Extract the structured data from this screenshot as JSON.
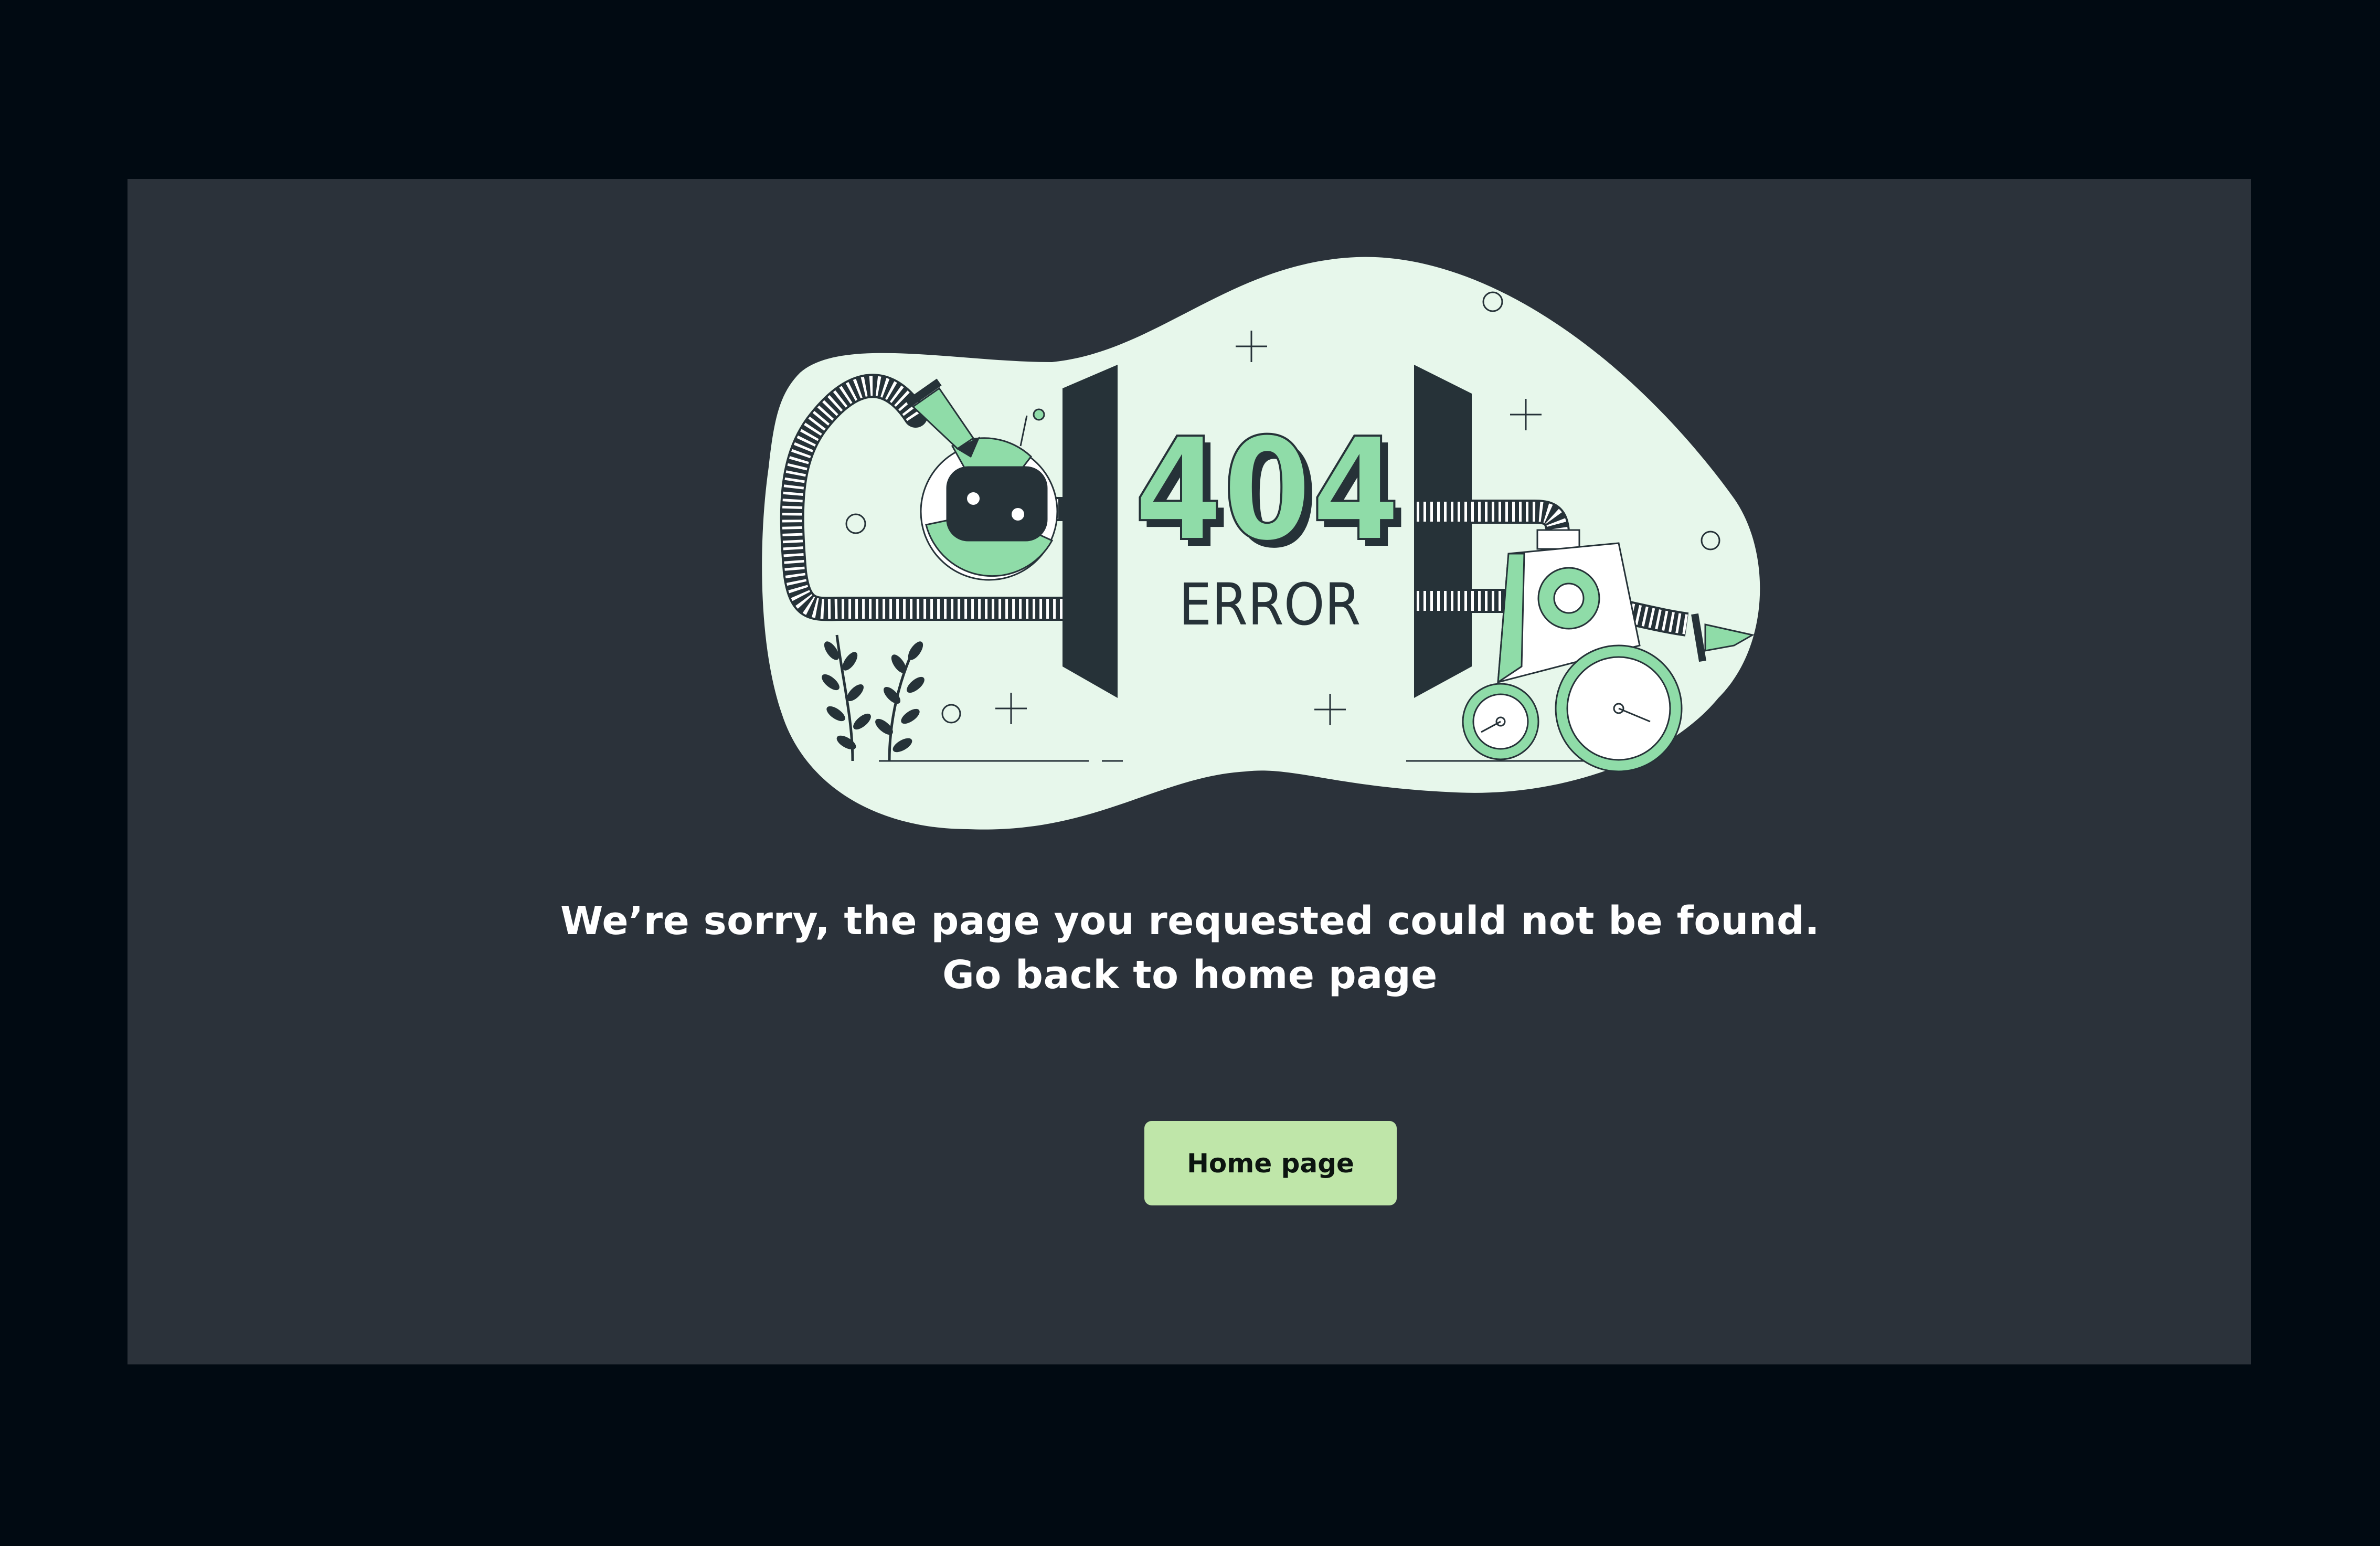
{
  "illustration": {
    "code": "404",
    "label": "ERROR"
  },
  "message": {
    "line1": "We’re sorry, the page you requested could not be  found.",
    "line2": "Go back to home page"
  },
  "home_button": {
    "label": "Home page"
  },
  "colors": {
    "outer_background": "#010a12",
    "panel": "#2b323a",
    "blob": "#e7f7eb",
    "accent_green": "#8fdca8",
    "button": "#bfe6a9",
    "ink": "#263238"
  }
}
